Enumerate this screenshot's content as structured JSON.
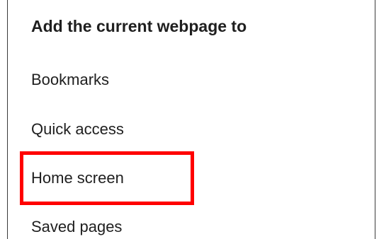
{
  "dialog": {
    "title": "Add the current webpage to",
    "options": [
      {
        "label": "Bookmarks"
      },
      {
        "label": "Quick access"
      },
      {
        "label": "Home screen",
        "highlighted": true
      },
      {
        "label": "Saved pages"
      }
    ]
  },
  "colors": {
    "background": "#ffffff",
    "text": "#202020",
    "highlight": "#ff0000",
    "border": "#3a3a3a"
  }
}
